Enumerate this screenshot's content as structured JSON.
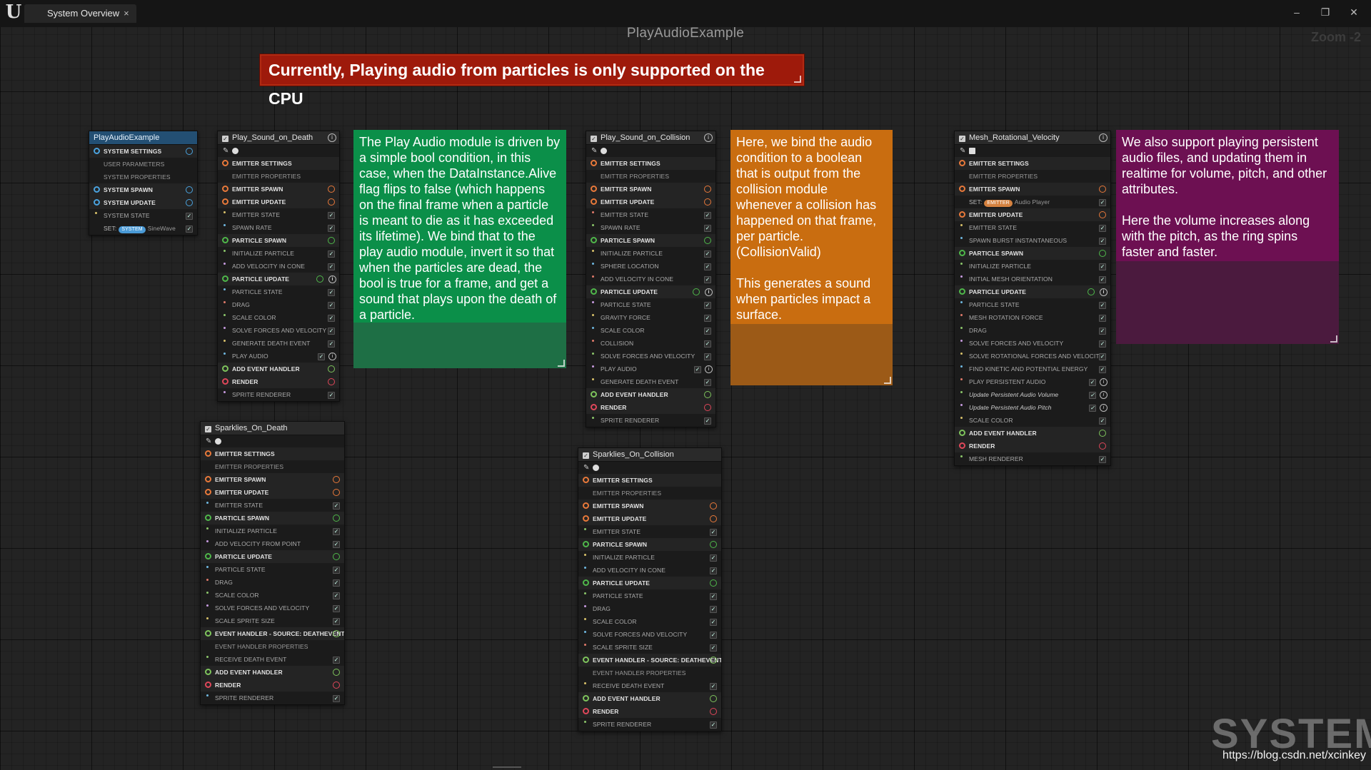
{
  "app": {
    "logo": "U",
    "tab_label": "System Overview",
    "tab_close": "×",
    "minimize": "–",
    "restore": "❐",
    "close": "✕"
  },
  "graph": {
    "title": "PlayAudioExample",
    "zoom": "Zoom -2"
  },
  "warning": "Currently, Playing audio from particles is only supported on the CPU",
  "comments": {
    "green": "The Play Audio module is driven by a simple bool condition, in this case, when the DataInstance.Alive flag flips to false (which happens on the final frame when a particle is meant to die as it has exceeded its lifetime). We bind that to the play audio module, invert it so that when the particles are dead, the bool is true for a frame, and get a sound that plays upon the death of a particle.",
    "orange": "Here, we bind the audio condition to a boolean that is output from the collision module whenever a collision has happened on that frame, per particle. (CollisionValid)\n\nThis generates a sound when particles impact a surface.",
    "purple": "We also support playing persistent audio files, and updating them in realtime for volume, pitch, and other attributes.\n\nHere the volume increases along with the pitch, as the ring spins faster and faster."
  },
  "colors": {
    "system": "#4aa3df",
    "emitter": "#e9793a",
    "particle": "#4fb84a",
    "render": "#e0475a",
    "event": "#7ec45c",
    "green_comment": "#0a8a48",
    "orange_comment": "#c46a12",
    "purple_comment": "#6e1052",
    "warning": "#9e1a0b"
  },
  "nodes": [
    {
      "title": "PlayAudioExample",
      "rows": [
        {
          "t": "SYSTEM SETTINGS",
          "k": "b",
          "c": "s"
        },
        {
          "t": "USER PARAMETERS",
          "k": "sub"
        },
        {
          "t": "SYSTEM PROPERTIES",
          "k": "sub"
        },
        {
          "t": "SYSTEM SPAWN",
          "k": "b",
          "c": "s"
        },
        {
          "t": "SYSTEM UPDATE",
          "k": "b",
          "c": "s"
        },
        {
          "t": "SYSTEM STATE",
          "k": "m"
        },
        {
          "t": "SineWave",
          "k": "set",
          "tag": "SYSTEM"
        }
      ]
    },
    {
      "title": "Play_Sound_on_Death",
      "rows": [
        {
          "t": "EMITTER SETTINGS",
          "k": "b"
        },
        {
          "t": "EMITTER PROPERTIES",
          "k": "sub"
        },
        {
          "t": "EMITTER SPAWN",
          "k": "b",
          "c": "e"
        },
        {
          "t": "EMITTER UPDATE",
          "k": "b",
          "c": "e"
        },
        {
          "t": "EMITTER STATE",
          "k": "m"
        },
        {
          "t": "SPAWN RATE",
          "k": "m"
        },
        {
          "t": "PARTICLE SPAWN",
          "k": "b",
          "c": "p"
        },
        {
          "t": "INITIALIZE PARTICLE",
          "k": "m"
        },
        {
          "t": "ADD VELOCITY IN CONE",
          "k": "m"
        },
        {
          "t": "PARTICLE UPDATE",
          "k": "b",
          "c": "p",
          "info": true
        },
        {
          "t": "PARTICLE STATE",
          "k": "m"
        },
        {
          "t": "DRAG",
          "k": "m"
        },
        {
          "t": "SCALE COLOR",
          "k": "m"
        },
        {
          "t": "SOLVE FORCES AND VELOCITY",
          "k": "m"
        },
        {
          "t": "GENERATE DEATH EVENT",
          "k": "m"
        },
        {
          "t": "PLAY AUDIO",
          "k": "m",
          "info": true
        },
        {
          "t": "ADD EVENT HANDLER",
          "k": "b",
          "c": "v"
        },
        {
          "t": "RENDER",
          "k": "b",
          "c": "r"
        },
        {
          "t": "SPRITE RENDERER",
          "k": "m"
        }
      ]
    },
    {
      "title": "Sparklies_On_Death",
      "rows": [
        {
          "t": "EMITTER SETTINGS",
          "k": "b"
        },
        {
          "t": "EMITTER PROPERTIES",
          "k": "sub"
        },
        {
          "t": "EMITTER SPAWN",
          "k": "b",
          "c": "e"
        },
        {
          "t": "EMITTER UPDATE",
          "k": "b",
          "c": "e"
        },
        {
          "t": "EMITTER STATE",
          "k": "m"
        },
        {
          "t": "PARTICLE SPAWN",
          "k": "b",
          "c": "p"
        },
        {
          "t": "INITIALIZE PARTICLE",
          "k": "m"
        },
        {
          "t": "ADD VELOCITY FROM POINT",
          "k": "m"
        },
        {
          "t": "PARTICLE UPDATE",
          "k": "b",
          "c": "p"
        },
        {
          "t": "PARTICLE STATE",
          "k": "m"
        },
        {
          "t": "DRAG",
          "k": "m"
        },
        {
          "t": "SCALE COLOR",
          "k": "m"
        },
        {
          "t": "SOLVE FORCES AND VELOCITY",
          "k": "m"
        },
        {
          "t": "SCALE SPRITE SIZE",
          "k": "m"
        },
        {
          "t": "EVENT HANDLER - SOURCE: DEATHEVENT",
          "k": "b",
          "c": "v"
        },
        {
          "t": "EVENT HANDLER PROPERTIES",
          "k": "sub"
        },
        {
          "t": "RECEIVE DEATH EVENT",
          "k": "m"
        },
        {
          "t": "ADD EVENT HANDLER",
          "k": "b",
          "c": "v"
        },
        {
          "t": "RENDER",
          "k": "b",
          "c": "r"
        },
        {
          "t": "SPRITE RENDERER",
          "k": "m"
        }
      ]
    },
    {
      "title": "Play_Sound_on_Collision",
      "rows": [
        {
          "t": "EMITTER SETTINGS",
          "k": "b"
        },
        {
          "t": "EMITTER PROPERTIES",
          "k": "sub"
        },
        {
          "t": "EMITTER SPAWN",
          "k": "b",
          "c": "e"
        },
        {
          "t": "EMITTER UPDATE",
          "k": "b",
          "c": "e"
        },
        {
          "t": "EMITTER STATE",
          "k": "m"
        },
        {
          "t": "SPAWN RATE",
          "k": "m"
        },
        {
          "t": "PARTICLE SPAWN",
          "k": "b",
          "c": "p"
        },
        {
          "t": "INITIALIZE PARTICLE",
          "k": "m"
        },
        {
          "t": "SPHERE LOCATION",
          "k": "m"
        },
        {
          "t": "ADD VELOCITY IN CONE",
          "k": "m"
        },
        {
          "t": "PARTICLE UPDATE",
          "k": "b",
          "c": "p",
          "info": true
        },
        {
          "t": "PARTICLE STATE",
          "k": "m"
        },
        {
          "t": "GRAVITY FORCE",
          "k": "m"
        },
        {
          "t": "SCALE COLOR",
          "k": "m"
        },
        {
          "t": "COLLISION",
          "k": "m"
        },
        {
          "t": "SOLVE FORCES AND VELOCITY",
          "k": "m"
        },
        {
          "t": "PLAY AUDIO",
          "k": "m",
          "info": true
        },
        {
          "t": "GENERATE DEATH EVENT",
          "k": "m"
        },
        {
          "t": "ADD EVENT HANDLER",
          "k": "b",
          "c": "v"
        },
        {
          "t": "RENDER",
          "k": "b",
          "c": "r"
        },
        {
          "t": "SPRITE RENDERER",
          "k": "m"
        }
      ]
    },
    {
      "title": "Sparklies_On_Collision",
      "rows": [
        {
          "t": "EMITTER SETTINGS",
          "k": "b"
        },
        {
          "t": "EMITTER PROPERTIES",
          "k": "sub"
        },
        {
          "t": "EMITTER SPAWN",
          "k": "b",
          "c": "e"
        },
        {
          "t": "EMITTER UPDATE",
          "k": "b",
          "c": "e"
        },
        {
          "t": "EMITTER STATE",
          "k": "m"
        },
        {
          "t": "PARTICLE SPAWN",
          "k": "b",
          "c": "p"
        },
        {
          "t": "INITIALIZE PARTICLE",
          "k": "m"
        },
        {
          "t": "ADD VELOCITY IN CONE",
          "k": "m"
        },
        {
          "t": "PARTICLE UPDATE",
          "k": "b",
          "c": "p"
        },
        {
          "t": "PARTICLE STATE",
          "k": "m"
        },
        {
          "t": "DRAG",
          "k": "m"
        },
        {
          "t": "SCALE COLOR",
          "k": "m"
        },
        {
          "t": "SOLVE FORCES AND VELOCITY",
          "k": "m"
        },
        {
          "t": "SCALE SPRITE SIZE",
          "k": "m"
        },
        {
          "t": "EVENT HANDLER - SOURCE: DEATHEVENT",
          "k": "b",
          "c": "v"
        },
        {
          "t": "EVENT HANDLER PROPERTIES",
          "k": "sub"
        },
        {
          "t": "RECEIVE DEATH EVENT",
          "k": "m"
        },
        {
          "t": "ADD EVENT HANDLER",
          "k": "b",
          "c": "v"
        },
        {
          "t": "RENDER",
          "k": "b",
          "c": "r"
        },
        {
          "t": "SPRITE RENDERER",
          "k": "m"
        }
      ]
    },
    {
      "title": "Mesh_Rotational_Velocity",
      "rows": [
        {
          "t": "EMITTER SETTINGS",
          "k": "b"
        },
        {
          "t": "EMITTER PROPERTIES",
          "k": "sub"
        },
        {
          "t": "EMITTER SPAWN",
          "k": "b",
          "c": "e"
        },
        {
          "t": "Audio Player",
          "k": "set",
          "tag": "EMITTER"
        },
        {
          "t": "EMITTER UPDATE",
          "k": "b",
          "c": "e"
        },
        {
          "t": "EMITTER STATE",
          "k": "m"
        },
        {
          "t": "SPAWN BURST INSTANTANEOUS",
          "k": "m"
        },
        {
          "t": "PARTICLE SPAWN",
          "k": "b",
          "c": "p"
        },
        {
          "t": "INITIALIZE PARTICLE",
          "k": "m"
        },
        {
          "t": "INITIAL MESH ORIENTATION",
          "k": "m"
        },
        {
          "t": "PARTICLE UPDATE",
          "k": "b",
          "c": "p",
          "info": true
        },
        {
          "t": "PARTICLE STATE",
          "k": "m"
        },
        {
          "t": "MESH ROTATION FORCE",
          "k": "m"
        },
        {
          "t": "DRAG",
          "k": "m"
        },
        {
          "t": "SOLVE FORCES AND VELOCITY",
          "k": "m"
        },
        {
          "t": "SOLVE ROTATIONAL FORCES AND VELOCITY",
          "k": "m"
        },
        {
          "t": "FIND KINETIC AND POTENTIAL ENERGY",
          "k": "m"
        },
        {
          "t": "PLAY PERSISTENT AUDIO",
          "k": "m",
          "info": true
        },
        {
          "t": "Update Persistent Audio Volume",
          "k": "h",
          "info": true
        },
        {
          "t": "Update Persistent Audio Pitch",
          "k": "h",
          "info": true
        },
        {
          "t": "SCALE COLOR",
          "k": "m"
        },
        {
          "t": "ADD EVENT HANDLER",
          "k": "b",
          "c": "v"
        },
        {
          "t": "RENDER",
          "k": "b",
          "c": "r"
        },
        {
          "t": "MESH RENDERER",
          "k": "m"
        }
      ]
    }
  ],
  "set_label": "SET:",
  "check": "✓",
  "info_glyph": "i",
  "pin_glyph": "✎",
  "watermark": "SYSTEM",
  "url": "https://blog.csdn.net/xcinkey"
}
